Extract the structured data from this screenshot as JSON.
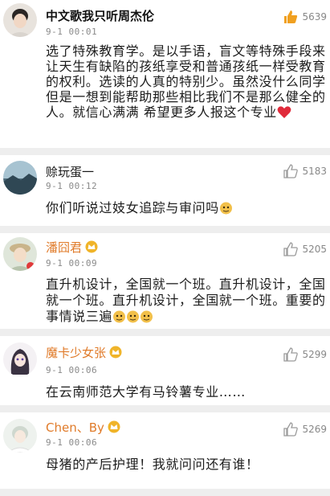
{
  "comments": [
    {
      "username": "中文歌我只听周杰伦",
      "time": "9-1 00:01",
      "likes": "5639",
      "text": "选了特殊教育学。是以手语，盲文等特殊手段来让天生有缺陷的孩纸享受和普通孩纸一样受教育的权利。选读的人真的特别少。虽然没什么同学  但是一想到能帮助那些相比我们不是那么健全的人。就信心满满  希望更多人报这个专业"
    },
    {
      "username": "赊玩蛋一",
      "time": "9-1 00:12",
      "likes": "5183",
      "text": "你们听说过妓女追踪与审问吗"
    },
    {
      "username": "潘囧君",
      "time": "9-1 00:09",
      "likes": "5205",
      "text": "直升机设计，全国就一个班。直升机设计，全国就一个班。直升机设计，全国就一个班。重要的事情说三遍"
    },
    {
      "username": "魔卡少女张",
      "time": "9-1 00:06",
      "likes": "5299",
      "text": "在云南师范大学有马铃薯专业……"
    },
    {
      "username": "Chen、By",
      "time": "9-1 00:06",
      "likes": "5269",
      "text": "母猪的产后护理！我就问问还有谁！"
    }
  ],
  "icons": {
    "like": "thumbs-up-icon",
    "emoji": "doge-emoji-icon",
    "heart": "heart-emoji-icon",
    "badge": "vip-crown-badge-icon"
  },
  "colors": {
    "username_orange": "#e07b2a",
    "like_active": "#f0a020",
    "like_inactive": "#9a9a9a",
    "separator": "#eeeeee"
  }
}
